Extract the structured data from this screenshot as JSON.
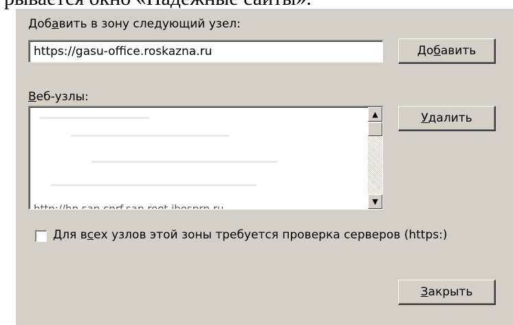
{
  "caption_fragment": "рывается окно «Надежные сайты».",
  "dialog": {
    "add_label_pre": "Доб",
    "add_label_key": "а",
    "add_label_post": "вить в зону следующий узел:",
    "url_value": "https://gasu-office.roskazna.ru",
    "add_button_pre": "До",
    "add_button_key": "б",
    "add_button_post": "авить",
    "sites_label_key": "В",
    "sites_label_post": "еб-узлы:",
    "sites_list_partial_row": "http://hp.sap.cprf.sap.root.jhosprp.ru",
    "remove_button_key": "У",
    "remove_button_post": "далить",
    "checkbox_label_pre": "Для в",
    "checkbox_label_key": "с",
    "checkbox_label_post": "ех узлов этой зоны требуется проверка серверов (https:)",
    "checkbox_checked": false,
    "close_button_key": "З",
    "close_button_post": "акрыть"
  },
  "icons": {
    "scroll_up": "scroll-up-arrow-icon",
    "scroll_down": "scroll-down-arrow-icon"
  },
  "colors": {
    "dialog_bg": "#d4d0c8",
    "field_bg": "#ffffff"
  }
}
